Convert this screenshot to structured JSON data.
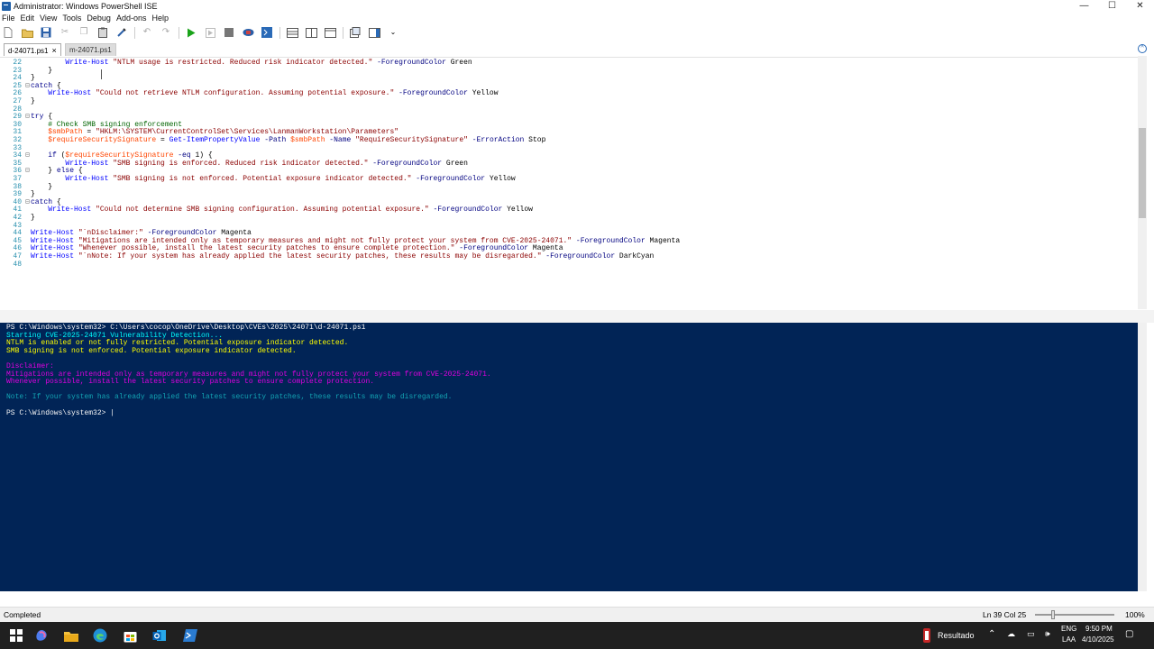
{
  "window": {
    "title": "Administrator: Windows PowerShell ISE",
    "minimize": "—",
    "maximize": "☐",
    "close": "✕"
  },
  "menu": [
    "File",
    "Edit",
    "View",
    "Tools",
    "Debug",
    "Add-ons",
    "Help"
  ],
  "tabs": [
    {
      "label": "d-24071.ps1",
      "active": true,
      "close": "×"
    },
    {
      "label": "m-24071.ps1",
      "active": false
    }
  ],
  "editor": {
    "lines": [
      {
        "n": "22",
        "indent": "        ",
        "cmd": "Write-Host",
        "str": " \"NTLM usage is restricted. Reduced risk indicator detected.\"",
        "param": " -ForegroundColor",
        "arg": " Green"
      },
      {
        "n": "23",
        "text": "    }"
      },
      {
        "n": "24",
        "text": "}"
      },
      {
        "n": "25",
        "kw": "catch",
        "text": " {"
      },
      {
        "n": "26",
        "indent": "    ",
        "cmd": "Write-Host",
        "str": " \"Could not retrieve NTLM configuration. Assuming potential exposure.\"",
        "param": " -ForegroundColor",
        "arg": " Yellow"
      },
      {
        "n": "27",
        "text": "}"
      },
      {
        "n": "28",
        "text": ""
      },
      {
        "n": "29",
        "kw": "try",
        "text": " {"
      },
      {
        "n": "30",
        "cmt": "    # Check SMB signing enforcement"
      },
      {
        "n": "31",
        "var": "    $smbPath",
        "text": " = ",
        "str": "\"HKLM:\\SYSTEM\\CurrentControlSet\\Services\\LanmanWorkstation\\Parameters\""
      },
      {
        "n": "32",
        "var": "    $requireSecuritySignature",
        "text": " = ",
        "cmd": "Get-ItemPropertyValue",
        "param": " -Path",
        "var2": " $smbPath",
        "param2": " -Name",
        "str": " \"RequireSecuritySignature\"",
        "param3": " -ErrorAction",
        "arg": " Stop"
      },
      {
        "n": "33",
        "text": ""
      },
      {
        "n": "34",
        "kw": "    if",
        "text": " (",
        "var": "$requireSecuritySignature",
        "param": " -eq",
        "arg": " 1) {"
      },
      {
        "n": "35",
        "indent": "        ",
        "cmd": "Write-Host",
        "str": " \"SMB signing is enforced. Reduced risk indicator detected.\"",
        "param": " -ForegroundColor",
        "arg": " Green"
      },
      {
        "n": "36",
        "text": "    } ",
        "kw": "else",
        "text2": " {"
      },
      {
        "n": "37",
        "indent": "        ",
        "cmd": "Write-Host",
        "str": " \"SMB signing is not enforced. Potential exposure indicator detected.\"",
        "param": " -ForegroundColor",
        "arg": " Yellow"
      },
      {
        "n": "38",
        "text": "    }"
      },
      {
        "n": "39",
        "text": "}"
      },
      {
        "n": "40",
        "kw": "catch",
        "text": " {"
      },
      {
        "n": "41",
        "indent": "    ",
        "cmd": "Write-Host",
        "str": " \"Could not determine SMB signing configuration. Assuming potential exposure.\"",
        "param": " -ForegroundColor",
        "arg": " Yellow"
      },
      {
        "n": "42",
        "text": "}"
      },
      {
        "n": "43",
        "text": ""
      },
      {
        "n": "44",
        "cmd": "Write-Host",
        "str": " \"`nDisclaimer:\"",
        "param": " -ForegroundColor",
        "arg": " Magenta"
      },
      {
        "n": "45",
        "cmd": "Write-Host",
        "str": " \"Mitigations are intended only as temporary measures and might not fully protect your system from CVE-2025-24071.\"",
        "param": " -ForegroundColor",
        "arg": " Magenta"
      },
      {
        "n": "46",
        "cmd": "Write-Host",
        "str": " \"Whenever possible, install the latest security patches to ensure complete protection.\"",
        "param": " -ForegroundColor",
        "arg": " Magenta"
      },
      {
        "n": "47",
        "cmd": "Write-Host",
        "str": " \"`nNote: If your system has already applied the latest security patches, these results may be disregarded.\"",
        "param": " -ForegroundColor",
        "arg": " DarkCyan"
      },
      {
        "n": "48",
        "text": ""
      }
    ]
  },
  "console": {
    "prompt_cmd": "PS C:\\Windows\\system32> C:\\Users\\cocop\\OneDrive\\Desktop\\CVEs\\2025\\24071\\d-24071.ps1",
    "line_start": "Starting CVE-2025-24071 Vulnerability Detection...",
    "line_ntlm": "NTLM is enabled or not fully restricted. Potential exposure indicator detected.",
    "line_smb": "SMB signing is not enforced. Potential exposure indicator detected.",
    "line_disclaimer": "Disclaimer:",
    "line_mitigations": "Mitigations are intended only as temporary measures and might not fully protect your system from CVE-2025-24071.",
    "line_whenever": "Whenever possible, install the latest security patches to ensure complete protection.",
    "line_note": "Note: If your system has already applied the latest security patches, these results may be disregarded.",
    "prompt_end": "PS C:\\Windows\\system32> |"
  },
  "status": {
    "state": "Completed",
    "position": "Ln 39  Col 25",
    "zoom": "100%"
  },
  "taskbar": {
    "tray_app": "Resultado",
    "language_top": "ENG",
    "language_bottom": "LAA",
    "time": "9:50 PM",
    "date": "4/10/2025"
  },
  "colors": {
    "console_bg": "#012456",
    "console_yellow": "#ffff00",
    "console_magenta": "#e000e0",
    "console_darkcyan": "#13a3b3"
  }
}
